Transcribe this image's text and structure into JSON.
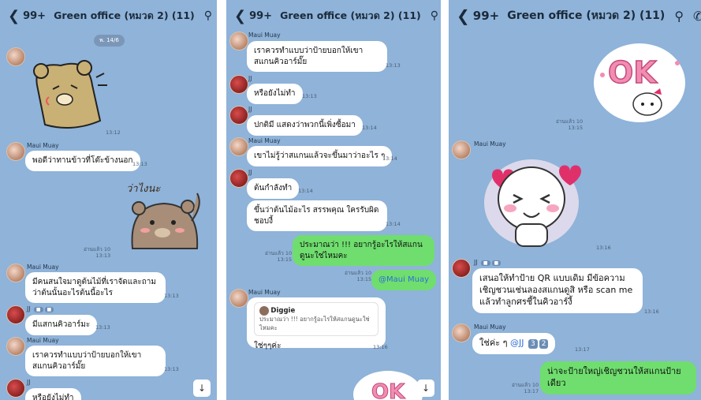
{
  "header": {
    "back_icon": "chevron-left",
    "unread": "99+",
    "title": "Green office (หมวด 2) (11)",
    "icons": [
      "search-icon",
      "phone-icon",
      "menu-icon"
    ]
  },
  "panel1": {
    "date": "พ. 14/6",
    "sticker1_time": "13:12",
    "msg1_name": "Maui Muay",
    "msg1_text": "พอดีว่าทานข้าวที่โต๊ะข้างนอก",
    "msg1_time": "13:13",
    "sticker2_caption": "ว่าไงนะ",
    "sticker2_read": "อ่านแล้ว 10",
    "sticker2_time": "13:13",
    "msg2_name": "Maui Muay",
    "msg2_text": "มีคนสนใจมาดูต้นไม้ที่เราจัดและถามว่าต้นนั้นอะไรต้นนี้อะไร",
    "msg2_time": "13:13",
    "msg3_name": "JJ",
    "msg3_text": "มีแสกนคิวอาร์มะ",
    "msg3_time": "13:13",
    "msg4_name": "Maui Muay",
    "msg4_text": "เราควรทำแบบว่าป้ายบอกให้เขาสแกนคิวอาร์มั๊ย",
    "msg4_time": "13:13",
    "msg5_name": "JJ",
    "msg5_text": "หรือยังไม่ทำ"
  },
  "panel2": {
    "msg1_name": "Maui Muay",
    "msg1_text": "เราควรทำแบบว่าป้ายบอกให้เขาสแกนคิวอาร์มั๊ย",
    "msg1_time": "13:13",
    "msg2_name": "JJ",
    "msg2_text": "หรือยังไม่ทำ",
    "msg2_time": "13:13",
    "msg3_name": "JJ",
    "msg3_text": "ปกติมี แสดงว่าพวกนี้เพิ่งซื้อมา",
    "msg3_time": "13:14",
    "msg4_name": "Maui Muay",
    "msg4_text": "เขาไม่รู้ว่าสแกนแล้วจะขึ้นมาว่าอะไร ๆ",
    "msg4_time": "13:14",
    "msg5_name": "JJ",
    "msg5_text": "ต้นกำลังทำ",
    "msg5_time": "13:14",
    "msg6_text": "ขึ้นว่าต้นไม้อะไร สรรพคุณ ใครรับผิดชอบงี้",
    "msg6_time": "13:14",
    "me1_read": "อ่านแล้ว 10",
    "me1_time": "13:15",
    "me1_text": "ประมาณว่า !!! อยากรู้อะไรให้สแกนดูนะใช่ไหมคะ",
    "me2_read": "อ่านแล้ว 10",
    "me2_time": "13:15",
    "me2_text": "@Maui Muay",
    "msg7_name": "Maui Muay",
    "quote_name": "Diggie",
    "quote_text": "ประมาณว่า !!! อยากรู้อะไรให้สแกนดูนะใช่ไหมคะ",
    "msg7_text": "ใช่ๆๆค่ะ",
    "msg7_time": "13:16",
    "sticker_ok": "OK"
  },
  "panel3": {
    "sticker_ok": "OK",
    "sticker1_read": "อ่านแล้ว 10",
    "sticker1_time": "13:15",
    "msg1_name": "Maui Muay",
    "sticker2_time": "13:16",
    "msg2_name": "JJ",
    "msg2_text": "เสนอให้ทำป้าย QR แบบเดิม มีข้อความเชิญชวนเช่นลองสแกนดูสิ หรือ scan me แล้วทำลูกศรชี้ในคิวอาร์งี้",
    "msg2_time": "13:16",
    "msg3_name": "Maui Muay",
    "msg3_text": "ใช่ค่ะ ๆ",
    "msg3_mention": "@JJ",
    "msg3_badges": [
      "3",
      "2"
    ],
    "msg3_time": "13:17",
    "me_read": "อ่านแล้ว 10",
    "me_time": "13:17",
    "me_text": "น่าจะป้ายใหญ่เชิญชวนให้สแกนป้ายเดียว"
  },
  "colors": {
    "chat_bg": "#8fb3d9",
    "my_bubble": "#6fde6e",
    "other_bubble": "#ffffff"
  }
}
